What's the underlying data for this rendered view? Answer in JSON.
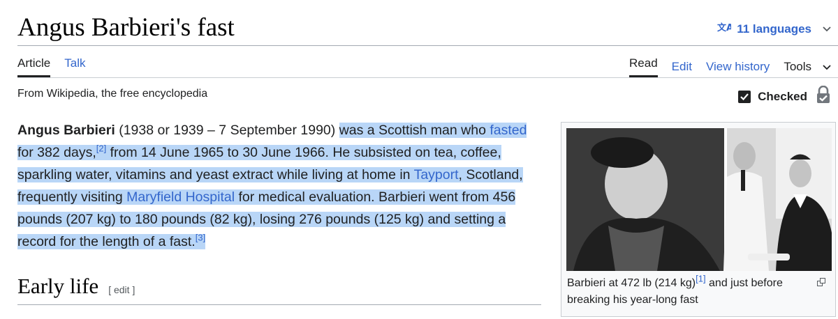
{
  "page": {
    "title": "Angus Barbieri's fast",
    "languages_label": "11 languages"
  },
  "tabs": {
    "article": "Article",
    "talk": "Talk",
    "read": "Read",
    "edit": "Edit",
    "view_history": "View history",
    "tools": "Tools"
  },
  "tagline": "From Wikipedia, the free encyclopedia",
  "checked_label": "Checked",
  "intro": {
    "name": "Angus Barbieri",
    "p1": " (1938 or 1939 – 7 September 1990) ",
    "p2": "was a Scottish man who ",
    "link_fasted": "fasted",
    "p3": " for 382 days,",
    "ref2": "[2]",
    "p4": " from 14 June 1965 to 30 June 1966. He subsisted on tea, coffee, sparkling water, vitamins and yeast extract while living at home in ",
    "link_tayport": "Tayport",
    "p5": ", Scotland, frequently visiting ",
    "link_maryfield": "Maryfield Hospital",
    "p6": " for medical evaluation. Barbieri went from 456 pounds (207 kg) to 180 pounds (82 kg), losing 276 pounds (125 kg) and setting a record for the length of a fast.",
    "ref3": "[3]"
  },
  "section": {
    "heading": "Early life",
    "edit_label": "[ edit ]"
  },
  "infobox": {
    "caption_a": "Barbieri at 472 lb (214 kg)",
    "ref1": "[1]",
    "caption_b": " and just before breaking his year-long fast"
  },
  "colors": {
    "link": "#3366cc",
    "selection": "#b9d6f7"
  }
}
